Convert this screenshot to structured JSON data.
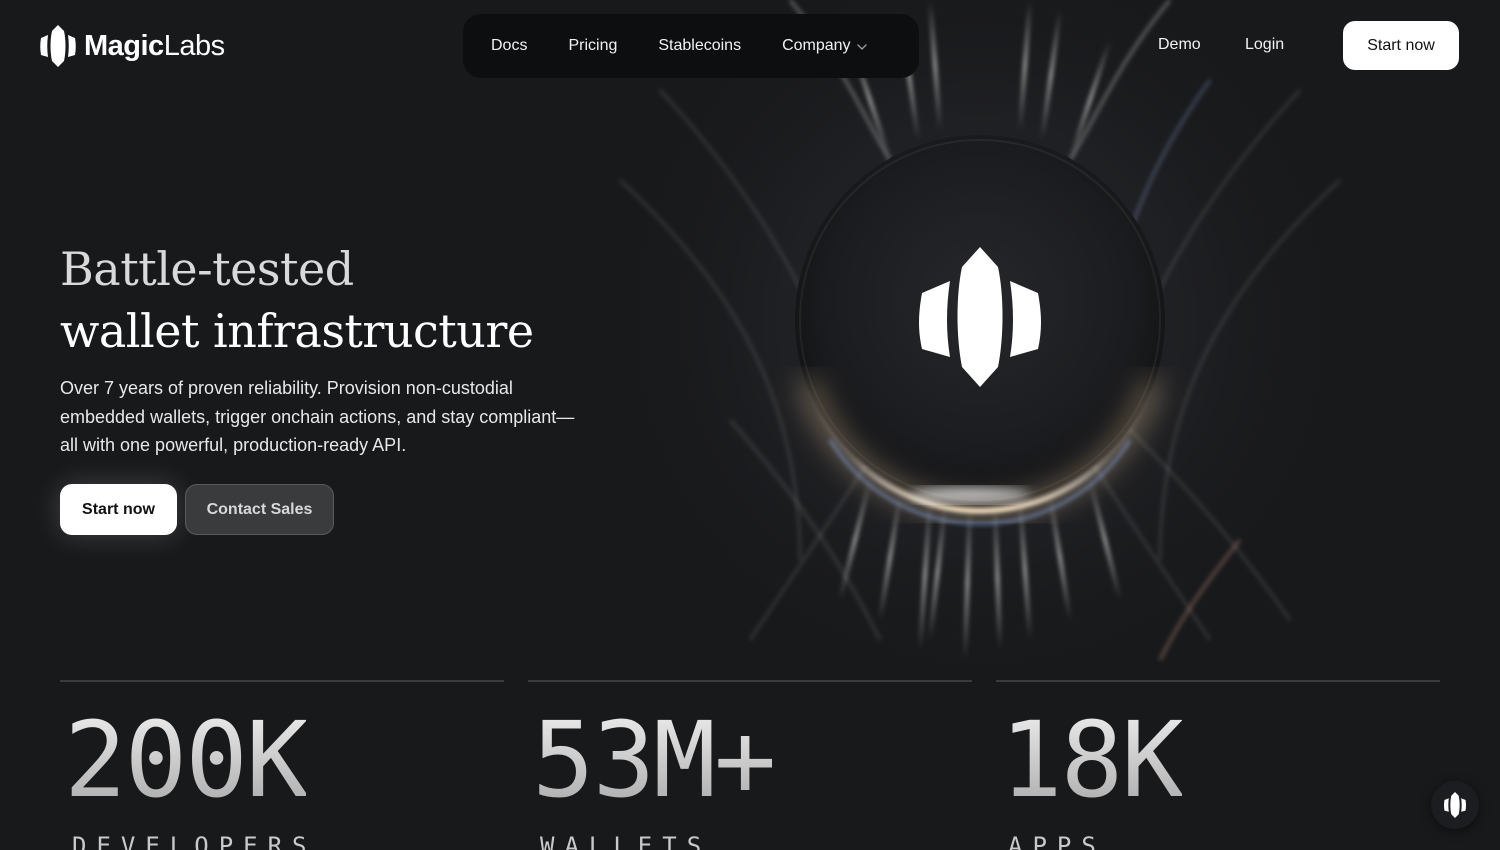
{
  "brand": {
    "name_bold": "Magic",
    "name_light": "Labs"
  },
  "nav": {
    "items": [
      {
        "label": "Docs"
      },
      {
        "label": "Pricing"
      },
      {
        "label": "Stablecoins"
      },
      {
        "label": "Company",
        "icon": "chevron-down-icon"
      }
    ]
  },
  "header": {
    "demo": "Demo",
    "login": "Login",
    "cta": "Start now"
  },
  "hero": {
    "title_line1": "Battle-tested",
    "title_line2": "wallet infrastructure",
    "subtitle": "Over 7 years of proven reliability. Provision non-custodial embedded wallets, trigger onchain actions, and stay compliant—all with one powerful, production-ready API.",
    "primary_cta": "Start now",
    "secondary_cta": "Contact Sales"
  },
  "stats": [
    {
      "value": "200K",
      "label": "DEVELOPERS"
    },
    {
      "value": "53M+",
      "label": "WALLETS"
    },
    {
      "value": "18K",
      "label": "APPS"
    }
  ],
  "widget": {
    "icon": "magic-logo-icon"
  },
  "colors": {
    "background": "#18191b",
    "nav_pill": "#0d0e10",
    "primary_button": "#ffffff",
    "secondary_button": "#3a3b3d",
    "text": "#ffffff"
  }
}
